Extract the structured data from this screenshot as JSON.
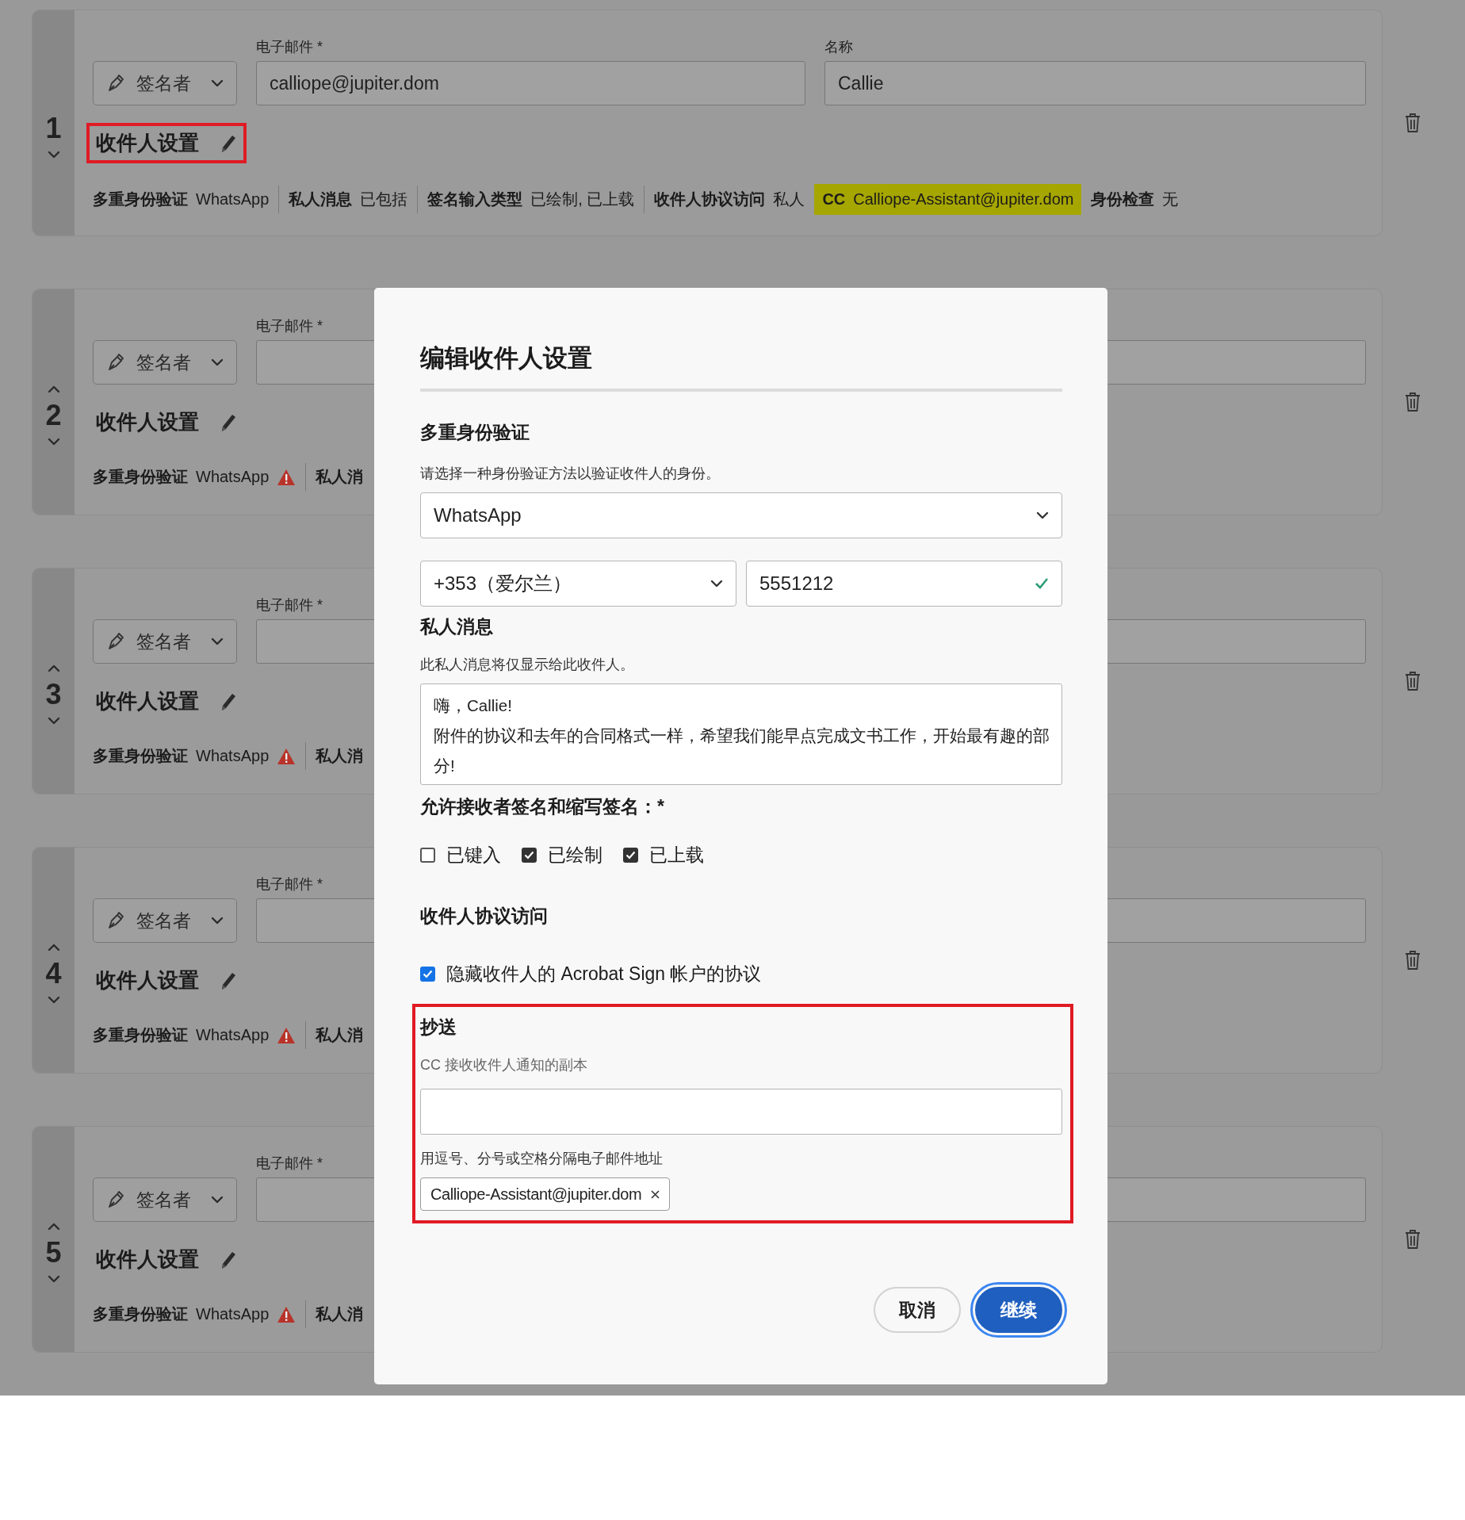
{
  "recipients": [
    {
      "number": "1",
      "can_move_up": false,
      "can_move_down": true,
      "role": "签名者",
      "email_label": "电子邮件",
      "required_mark": "*",
      "email": "calliope@jupiter.dom",
      "name_label": "名称",
      "name": "Callie",
      "settings_label": "收件人设置",
      "highlighted": true,
      "meta": [
        {
          "label": "多重身份验证",
          "value": "WhatsApp",
          "warning": false,
          "highlighted": false
        },
        {
          "label": "私人消息",
          "value": "已包括",
          "warning": false,
          "highlighted": false
        },
        {
          "label": "签名输入类型",
          "value": "已绘制, 已上载",
          "warning": false,
          "highlighted": false
        },
        {
          "label": "收件人协议访问",
          "value": "私人",
          "warning": false,
          "highlighted": false
        },
        {
          "label": "CC",
          "value": "Calliope-Assistant@jupiter.dom",
          "warning": false,
          "highlighted": true
        },
        {
          "label": "身份检查",
          "value": "无",
          "warning": false,
          "highlighted": false
        }
      ]
    },
    {
      "number": "2",
      "can_move_up": true,
      "can_move_down": true,
      "role": "签名者",
      "email_label": "电子邮件",
      "required_mark": "*",
      "settings_label": "收件人设置",
      "highlighted": false,
      "meta": [
        {
          "label": "多重身份验证",
          "value": "WhatsApp",
          "warning": true,
          "highlighted": false
        },
        {
          "label": "私人消",
          "warning": false,
          "highlighted": false
        }
      ]
    },
    {
      "number": "3",
      "can_move_up": true,
      "can_move_down": true,
      "role": "签名者",
      "email_label": "电子邮件",
      "required_mark": "*",
      "settings_label": "收件人设置",
      "highlighted": false,
      "meta": [
        {
          "label": "多重身份验证",
          "value": "WhatsApp",
          "warning": true,
          "highlighted": false
        },
        {
          "label": "私人消",
          "warning": false,
          "highlighted": false
        }
      ]
    },
    {
      "number": "4",
      "can_move_up": true,
      "can_move_down": true,
      "role": "签名者",
      "email_label": "电子邮件",
      "required_mark": "*",
      "settings_label": "收件人设置",
      "highlighted": false,
      "meta": [
        {
          "label": "多重身份验证",
          "value": "WhatsApp",
          "warning": true,
          "highlighted": false
        },
        {
          "label": "私人消",
          "warning": false,
          "highlighted": false
        }
      ]
    },
    {
      "number": "5",
      "can_move_up": true,
      "can_move_down": true,
      "role": "签名者",
      "email_label": "电子邮件",
      "required_mark": "*",
      "settings_label": "收件人设置",
      "highlighted": false,
      "meta": [
        {
          "label": "多重身份验证",
          "value": "WhatsApp",
          "warning": true,
          "highlighted": false
        },
        {
          "label": "私人消",
          "warning": false,
          "highlighted": false
        }
      ]
    }
  ],
  "dialog": {
    "title": "编辑收件人设置",
    "mfa": {
      "heading": "多重身份验证",
      "description": "请选择一种身份验证方法以验证收件人的身份。",
      "method": "WhatsApp",
      "country": "+353（爱尔兰）",
      "phone": "5551212",
      "phone_valid": true
    },
    "private_message": {
      "heading": "私人消息",
      "description": "此私人消息将仅显示给此收件人。",
      "lines": [
        "嗨，Callie!",
        "附件的协议和去年的合同格式一样，希望我们能早点完成文书工作，开始最有趣的部分!"
      ]
    },
    "signature_types": {
      "heading": "允许接收者签名和缩写签名：*",
      "options": [
        {
          "label": "已键入",
          "checked": false
        },
        {
          "label": "已绘制",
          "checked": true
        },
        {
          "label": "已上载",
          "checked": true
        }
      ]
    },
    "agreement_access": {
      "heading": "收件人协议访问",
      "option": {
        "label": "隐藏收件人的 Acrobat Sign 帐户的协议",
        "checked": true
      }
    },
    "cc": {
      "heading": "抄送",
      "description": "CC 接收收件人通知的副本",
      "hint": "用逗号、分号或空格分隔电子邮件地址",
      "chips": [
        "Calliope-Assistant@jupiter.dom"
      ],
      "highlighted": true
    },
    "buttons": [
      {
        "label": "取消",
        "kind": "secondary"
      },
      {
        "label": "继续",
        "kind": "primary"
      }
    ]
  }
}
